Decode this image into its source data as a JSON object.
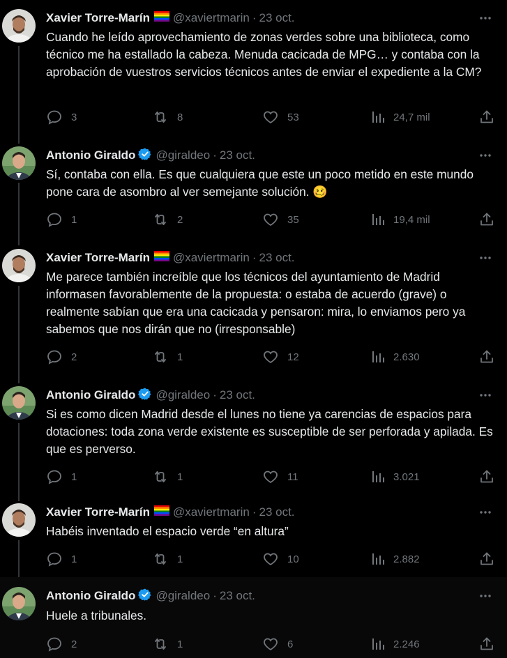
{
  "tweets": [
    {
      "author": "Xavier Torre-Marín",
      "handle": "@xaviertmarin",
      "date": "23 oct.",
      "avatar": "avatar-xavier",
      "flag": true,
      "verified": false,
      "text": "Cuando he leído aprovechamiento de zonas verdes sobre una biblioteca, como técnico me ha estallado la cabeza. Menuda cacicada de MPG… y contaba con la aprobación de vuestros servicios técnicos antes de enviar el expediente a la CM?",
      "replies": "3",
      "retweets": "8",
      "likes": "53",
      "views": "24,7 mil"
    },
    {
      "author": "Antonio Giraldo",
      "handle": "@giraldeo",
      "date": "23 oct.",
      "avatar": "avatar-antonio",
      "flag": false,
      "verified": true,
      "text": "Sí, contaba con ella. Es que cualquiera que este un poco metido en este mundo pone cara de asombro al ver semejante solución. 🥴",
      "replies": "1",
      "retweets": "2",
      "likes": "35",
      "views": "19,4 mil"
    },
    {
      "author": "Xavier Torre-Marín",
      "handle": "@xaviertmarin",
      "date": "23 oct.",
      "avatar": "avatar-xavier",
      "flag": true,
      "verified": false,
      "text": "Me parece también increíble que los técnicos del ayuntamiento de Madrid informasen favorablemente de la propuesta: o estaba de acuerdo (grave) o realmente sabían que era una cacicada y pensaron: mira, lo enviamos pero ya sabemos que nos dirán que no (irresponsable)",
      "replies": "2",
      "retweets": "1",
      "likes": "12",
      "views": "2.630"
    },
    {
      "author": "Antonio Giraldo",
      "handle": "@giraldeo",
      "date": "23 oct.",
      "avatar": "avatar-antonio",
      "flag": false,
      "verified": true,
      "text": "Si es como dicen Madrid desde el lunes no tiene ya carencias de espacios para dotaciones: toda zona verde existente es susceptible de ser perforada y apilada. Es que es perverso.",
      "replies": "1",
      "retweets": "1",
      "likes": "11",
      "views": "3.021"
    },
    {
      "author": "Xavier Torre-Marín",
      "handle": "@xaviertmarin",
      "date": "23 oct.",
      "avatar": "avatar-xavier",
      "flag": true,
      "verified": false,
      "text": "Habéis inventado el espacio verde “en altura”",
      "replies": "1",
      "retweets": "1",
      "likes": "10",
      "views": "2.882"
    },
    {
      "author": "Antonio Giraldo",
      "handle": "@giraldeo",
      "date": "23 oct.",
      "avatar": "avatar-antonio",
      "flag": false,
      "verified": true,
      "text": "Huele a tribunales.",
      "replies": "2",
      "retweets": "1",
      "likes": "6",
      "views": "2.246"
    }
  ],
  "colors": {
    "background": "#000000",
    "text": "#e7e9ea",
    "muted": "#71767b",
    "verified": "#1d9bf0",
    "thread_line": "#333639"
  }
}
